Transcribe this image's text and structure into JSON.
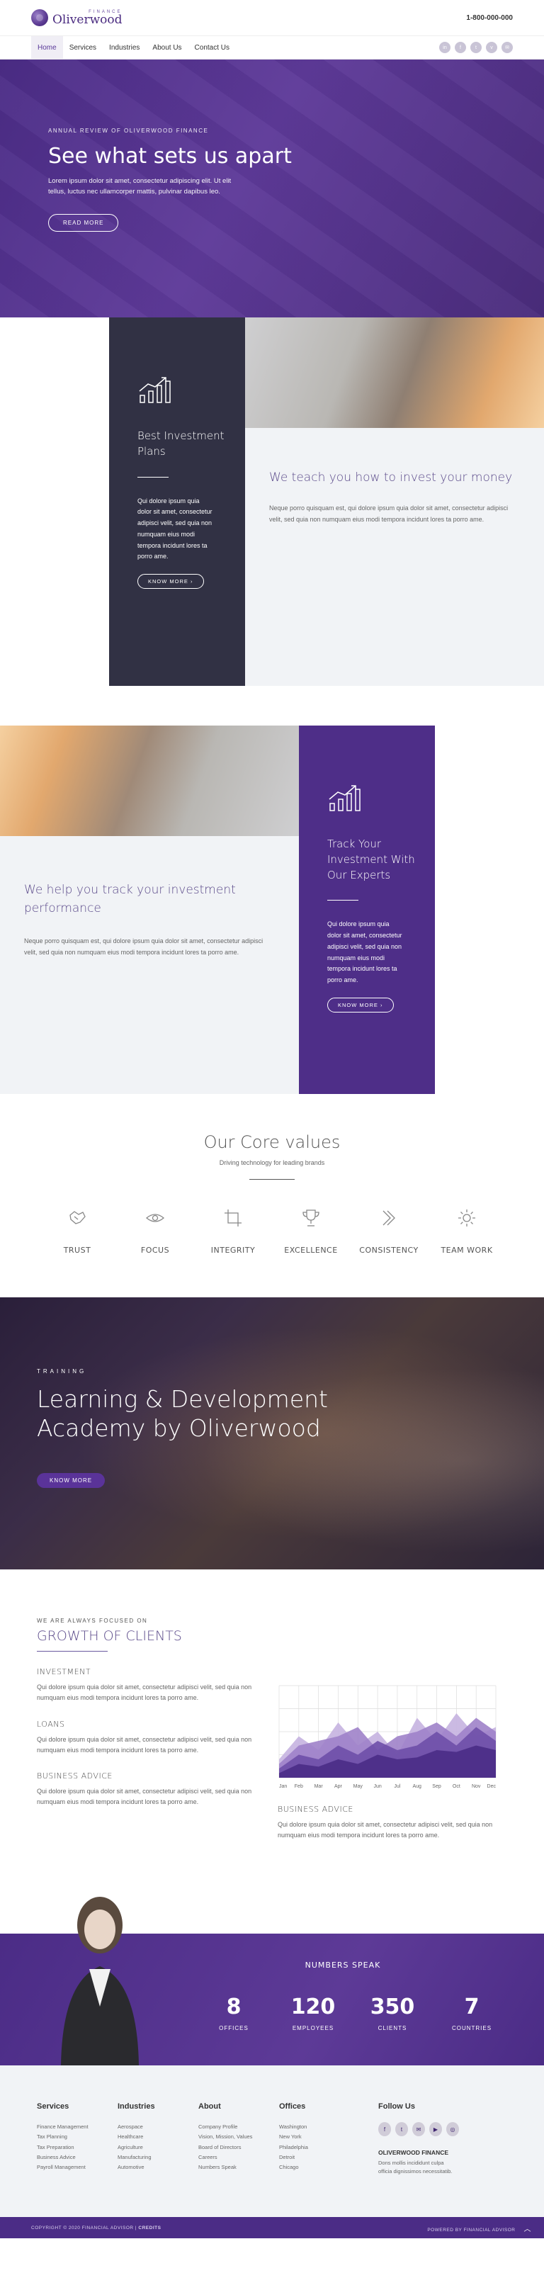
{
  "header": {
    "logo_small": "FINANCE",
    "logo_big": "Oliverwood",
    "phone": "1-800-000-000"
  },
  "nav": {
    "items": [
      "Home",
      "Services",
      "Industries",
      "About Us",
      "Contact Us"
    ],
    "active": "Home",
    "social_icons": [
      "linkedin-icon",
      "facebook-icon",
      "twitter-icon",
      "vimeo-icon",
      "email-icon"
    ]
  },
  "hero": {
    "eyebrow": "ANNUAL REVIEW OF OLIVERWOOD FINANCE",
    "title": "See what sets us apart",
    "text": "Lorem ipsum dolor sit amet, consectetur adipiscing elit. Ut elit tellus, luctus nec ullamcorper mattis, pulvinar dapibus leo.",
    "button": "READ MORE"
  },
  "section1": {
    "card_title": "Best Investment Plans",
    "card_text": "Qui dolore ipsum quia dolor sit amet, consectetur adipisci velit, sed quia non numquam eius modi tempora incidunt lores ta porro ame.",
    "card_button": "KNOW MORE  ›",
    "heading": "We teach you how to invest your money",
    "text": "Neque porro quisquam est, qui dolore ipsum quia dolor sit amet, consectetur adipisci velit, sed quia non numquam eius modi tempora incidunt lores ta porro ame."
  },
  "section2": {
    "heading": "We help you track your investment performance",
    "text": "Neque porro quisquam est, qui dolore ipsum quia dolor sit amet, consectetur adipisci velit, sed quia non numquam eius modi tempora incidunt lores ta porro ame.",
    "card_title": "Track Your Investment With Our Experts",
    "card_text": "Qui dolore ipsum quia dolor sit amet, consectetur adipisci velit, sed quia non numquam eius modi tempora incidunt lores ta porro ame.",
    "card_button": "KNOW MORE  ›"
  },
  "core": {
    "title": "Our Core values",
    "subtitle": "Driving technology for leading brands",
    "values": [
      {
        "label": "TRUST",
        "icon": "handshake-icon"
      },
      {
        "label": "FOCUS",
        "icon": "eye-icon"
      },
      {
        "label": "INTEGRITY",
        "icon": "crop-icon"
      },
      {
        "label": "EXCELLENCE",
        "icon": "trophy-icon"
      },
      {
        "label": "CONSISTENCY",
        "icon": "chevrons-icon"
      },
      {
        "label": "TEAM WORK",
        "icon": "gear-icon"
      }
    ]
  },
  "training": {
    "eyebrow": "TRAINING",
    "title_line1": "Learning & Development",
    "title_line2": "Academy by Oliverwood",
    "button": "KNOW MORE"
  },
  "growth": {
    "eyebrow": "WE ARE ALWAYS FOCUSED ON",
    "title": "GROWTH OF CLIENTS",
    "items": [
      {
        "title": "INVESTMENT",
        "text": "Qui dolore ipsum quia dolor sit amet, consectetur adipisci velit, sed quia non numquam eius modi tempora incidunt lores ta porro ame."
      },
      {
        "title": "LOANS",
        "text": "Qui dolore ipsum quia dolor sit amet, consectetur adipisci velit, sed quia non numquam eius modi tempora incidunt lores ta porro ame."
      },
      {
        "title": "BUSINESS ADVICE",
        "text": "Qui dolore ipsum quia dolor sit amet, consectetur adipisci velit, sed quia non numquam eius modi tempora incidunt lores ta porro ame."
      }
    ],
    "right_item": {
      "title": "BUSINESS ADVICE",
      "text": "Qui dolore ipsum quia dolor sit amet, consectetur adipisci velit, sed quia non numquam eius modi tempora incidunt lores ta porro ame."
    }
  },
  "chart_data": {
    "type": "area",
    "categories": [
      "Jan",
      "Feb",
      "Mar",
      "Apr",
      "May",
      "Jun",
      "Jul",
      "Aug",
      "Sep",
      "Oct",
      "Nov",
      "Dec"
    ],
    "series": [
      {
        "values": [
          20,
          45,
          30,
          60,
          35,
          50,
          25,
          65,
          40,
          70,
          45,
          55
        ],
        "color": "#c5b3e0"
      },
      {
        "values": [
          15,
          35,
          40,
          45,
          55,
          30,
          45,
          50,
          60,
          45,
          65,
          50
        ],
        "color": "#9e82c9"
      },
      {
        "values": [
          10,
          25,
          20,
          35,
          25,
          40,
          30,
          35,
          50,
          35,
          55,
          40
        ],
        "color": "#6e4fa8"
      },
      {
        "values": [
          5,
          15,
          12,
          20,
          15,
          25,
          20,
          22,
          30,
          28,
          35,
          30
        ],
        "color": "#4a2c86"
      }
    ],
    "ylim": [
      0,
      100
    ],
    "grid": true
  },
  "numbers": {
    "title": "NUMBERS SPEAK",
    "stats": [
      {
        "value": "8",
        "label": "OFFICES"
      },
      {
        "value": "120",
        "label": "EMPLOYEES"
      },
      {
        "value": "350",
        "label": "CLIENTS"
      },
      {
        "value": "7",
        "label": "COUNTRIES"
      }
    ]
  },
  "footer": {
    "columns": [
      {
        "title": "Services",
        "items": [
          "Finance Management",
          "Tax Planning",
          "Tax Preparation",
          "Business Advice",
          "Payroll Management"
        ]
      },
      {
        "title": "Industries",
        "items": [
          "Aerospace",
          "Healthcare",
          "Agriculture",
          "Manufacturing",
          "Automotive"
        ]
      },
      {
        "title": "About",
        "items": [
          "Company Profile",
          "Vision, Mission, Values",
          "Board of Directors",
          "Careers",
          "Numbers Speak"
        ]
      },
      {
        "title": "Offices",
        "items": [
          "Washington",
          "New York",
          "Philadelphia",
          "Detroit",
          "Chicago"
        ]
      }
    ],
    "follow_title": "Follow Us",
    "follow_icons": [
      "facebook-icon",
      "twitter-icon",
      "email-icon",
      "youtube-icon",
      "instagram-icon"
    ],
    "brand_title": "OLIVERWOOD FINANCE",
    "brand_text": "Dons mollis incididunt culpa officia dignissimos necessitatib.",
    "copyright": "COPYRIGHT © 2020 FINANCIAL ADVISOR | ",
    "credits": "CREDITS",
    "powered": "POWERED BY FINANCIAL ADVISOR"
  }
}
